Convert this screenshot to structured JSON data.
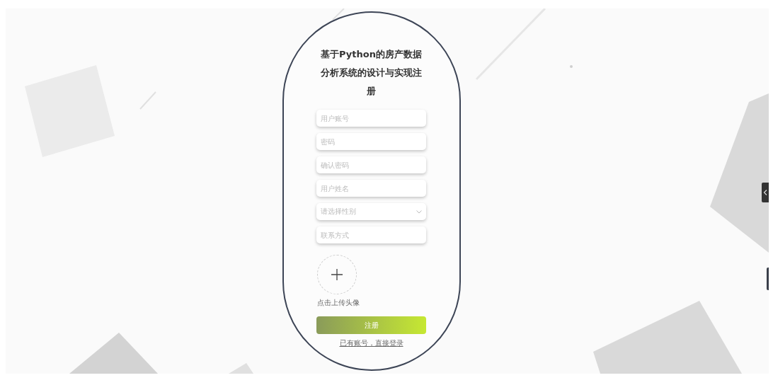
{
  "form": {
    "title": "基于Python的房产数据分析系统的设计与实现注册",
    "fields": [
      {
        "kind": "input",
        "placeholder": "用户账号"
      },
      {
        "kind": "input",
        "placeholder": "密码"
      },
      {
        "kind": "input",
        "placeholder": "确认密码"
      },
      {
        "kind": "input",
        "placeholder": "用户姓名"
      },
      {
        "kind": "select",
        "placeholder": "请选择性别"
      },
      {
        "kind": "input",
        "placeholder": "联系方式"
      }
    ],
    "upload": {
      "label": "点击上传头像"
    },
    "submit": "注册",
    "login_link": "已有账号，直接登录"
  }
}
